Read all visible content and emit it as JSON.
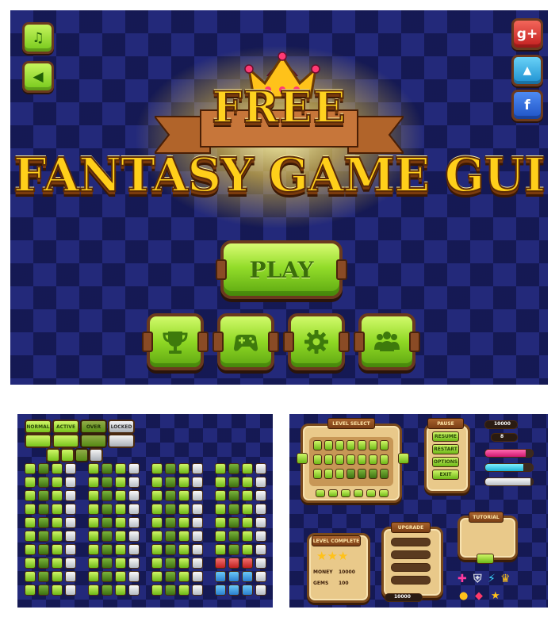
{
  "hero": {
    "title_top": "FREE",
    "title_main": "FANTASY GAME GUI",
    "play_label": "PLAY",
    "left_buttons": [
      {
        "name": "music-button",
        "icon": "music-note-icon",
        "glyph": "♫"
      },
      {
        "name": "sound-button",
        "icon": "speaker-icon",
        "glyph": "◀"
      }
    ],
    "social_buttons": [
      {
        "name": "google-plus-button",
        "icon": "google-plus-icon",
        "glyph": "g+",
        "color": "red"
      },
      {
        "name": "twitter-button",
        "icon": "twitter-bird-icon",
        "glyph": "🐦",
        "color": "sky"
      },
      {
        "name": "facebook-button",
        "icon": "facebook-icon",
        "glyph": "f",
        "color": "blue"
      }
    ],
    "tiles": [
      {
        "name": "trophy-button",
        "icon": "trophy-icon"
      },
      {
        "name": "gamepad-button",
        "icon": "gamepad-icon"
      },
      {
        "name": "settings-button",
        "icon": "gear-icon"
      },
      {
        "name": "multiplayer-button",
        "icon": "users-icon"
      }
    ],
    "colors": {
      "background": "#23297a",
      "accent_green": "#8fd824",
      "title_gold": "#ffd21f",
      "frame_brown": "#6b3a1e"
    }
  },
  "icons_panel": {
    "labels_row1": [
      "NORMAL",
      "ACTIVE",
      "OVER",
      "LOCKED"
    ]
  },
  "screens_panel": {
    "level_select_title": "LEVEL SELECT",
    "pause_title": "PAUSE",
    "pause_buttons": [
      "RESUME",
      "RESTART",
      "OPTIONS",
      "EXIT"
    ],
    "counter_value": "10000",
    "heart_count": "8",
    "level_complete_title": "LEVEL COMPLETE",
    "level_complete_rows": [
      {
        "label": "MONEY",
        "value": "10000"
      },
      {
        "label": "GEMS",
        "value": "100"
      }
    ],
    "upgrade_title": "UPGRADE",
    "tutorial_title": "TUTORIAL",
    "bottom_counter": "10000"
  }
}
